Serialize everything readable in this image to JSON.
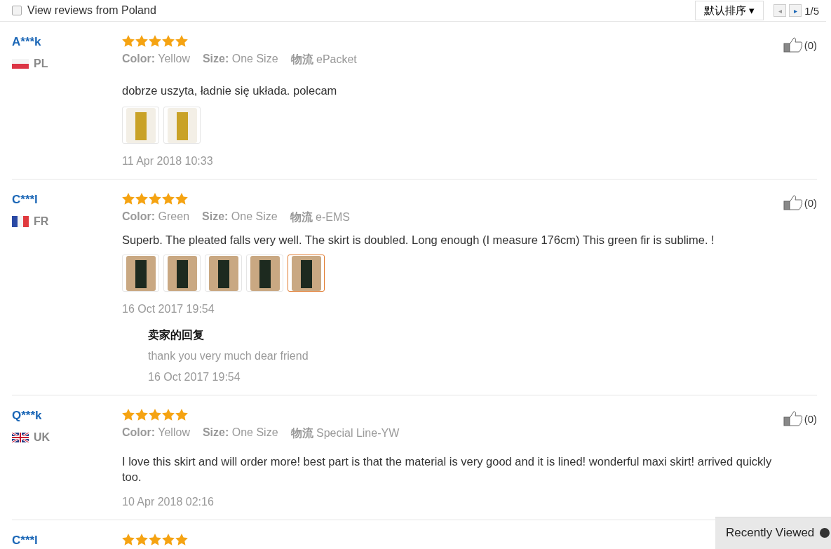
{
  "toolbar": {
    "filter": {
      "label": "View reviews from Poland",
      "checked": false
    },
    "sort": {
      "label": "默认排序",
      "caret": "▾"
    },
    "pager": {
      "prev": "◂",
      "next": "▸",
      "page": "1/5"
    }
  },
  "reviews": [
    {
      "name": "A***k",
      "flag": {
        "kind": "bicolor"
      },
      "country": "PL",
      "stars": 5,
      "attributes": [
        {
          "label": "Color:",
          "value": "Yellow"
        },
        {
          "label": "Size:",
          "value": "One Size"
        },
        {
          "label": "物流",
          "value": "ePacket"
        }
      ],
      "text": "dobrze uszyta, ładnie się układa. polecam",
      "photos": [
        {
          "kind": "yellow",
          "selected": false
        },
        {
          "kind": "yellow",
          "selected": false
        }
      ],
      "date": "11 Apr 2018 10:33",
      "likes": "(0)"
    },
    {
      "name": "C***l",
      "flag": {
        "kind": "tricolor"
      },
      "country": "FR",
      "stars": 5,
      "attributes": [
        {
          "label": "Color:",
          "value": "Green"
        },
        {
          "label": "Size:",
          "value": "One Size"
        },
        {
          "label": "物流",
          "value": "e-EMS"
        }
      ],
      "text": "Superb. The pleated falls very well. The skirt is doubled. Long enough (I measure 176cm) This green fir is sublime. !",
      "photos": [
        {
          "kind": "green",
          "selected": false
        },
        {
          "kind": "green",
          "selected": false
        },
        {
          "kind": "green",
          "selected": false
        },
        {
          "kind": "green",
          "selected": false
        },
        {
          "kind": "green",
          "selected": true
        }
      ],
      "date": "16 Oct 2017 19:54",
      "reply": {
        "title": "卖家的回复",
        "text": "thank you very much dear friend",
        "date": "16 Oct 2017 19:54"
      },
      "likes": "(0)"
    },
    {
      "name": "Q***k",
      "flag": {
        "kind": "union"
      },
      "country": "UK",
      "stars": 5,
      "attributes": [
        {
          "label": "Color:",
          "value": "Yellow"
        },
        {
          "label": "Size:",
          "value": "One Size"
        },
        {
          "label": "物流",
          "value": "Special Line-YW"
        }
      ],
      "text": "I love this skirt and will order more! best part is that the material is very good and it is lined! wonderful maxi skirt! arrived quickly too.",
      "date": "10 Apr 2018 02:16",
      "likes": "(0)"
    },
    {
      "name": "C***l",
      "stars": 5
    }
  ],
  "recently_viewed": {
    "label": "Recently Viewed"
  }
}
